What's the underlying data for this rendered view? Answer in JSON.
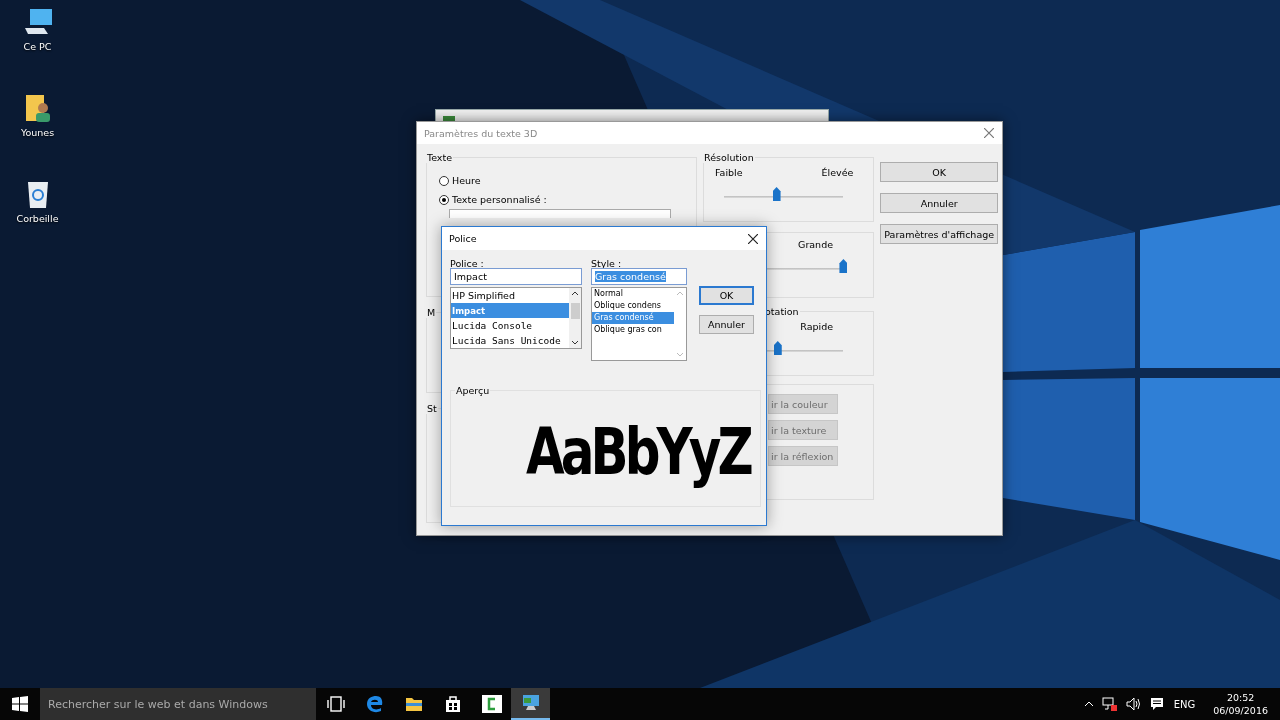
{
  "desktop_icons": [
    {
      "label": "Ce PC",
      "kind": "computer"
    },
    {
      "label": "Younes",
      "kind": "user-folder"
    },
    {
      "label": "Corbeille",
      "kind": "recycle-bin"
    }
  ],
  "main_dialog": {
    "title": "Paramètres du texte 3D",
    "text_group": {
      "label": "Texte",
      "options": [
        {
          "label": "Heure",
          "selected": false
        },
        {
          "label": "Texte personnalisé :",
          "selected": true
        }
      ]
    },
    "group_2_label": "M",
    "group_3_label": "St",
    "resolution": {
      "label": "Résolution",
      "min_label": "Faible",
      "max_label": "Élevée",
      "level": 0.44
    },
    "size": {
      "max_label": "Grande",
      "level": 1.0
    },
    "rotation": {
      "label": "otation",
      "max_label": "Rapide",
      "level": 0.45
    },
    "surface_buttons": [
      "ir la couleur",
      "ir la texture",
      "ir la réflexion"
    ],
    "buttons": [
      "OK",
      "Annuler",
      "Paramètres d'affichage"
    ]
  },
  "font_dialog": {
    "title": "Police",
    "font": {
      "label": "Police :",
      "value": "Impact",
      "items": [
        {
          "label": "HP Simplified",
          "selected": false,
          "kind": "sans"
        },
        {
          "label": "Impact",
          "selected": true,
          "kind": "impact"
        },
        {
          "label": "Lucida Console",
          "selected": false,
          "kind": "mono"
        },
        {
          "label": "Lucida Sans Unicode",
          "selected": false,
          "kind": "mono"
        }
      ]
    },
    "style": {
      "label": "Style :",
      "value": "Gras condensé",
      "value_highlighted": true,
      "items": [
        {
          "label": "Normal",
          "selected": false
        },
        {
          "label": "Oblique condens",
          "selected": false
        },
        {
          "label": "Gras condensé",
          "selected": true
        },
        {
          "label": "Oblique gras con",
          "selected": false
        }
      ]
    },
    "buttons": [
      "OK",
      "Annuler"
    ],
    "preview": {
      "label": "Aperçu",
      "sample": "AaBbYyZ"
    }
  },
  "taskbar": {
    "search_placeholder": "Rechercher sur le web et dans Windows",
    "apps": [
      {
        "kind": "task-view",
        "active": false
      },
      {
        "kind": "edge",
        "active": false
      },
      {
        "kind": "explorer",
        "active": false
      },
      {
        "kind": "store",
        "active": false
      },
      {
        "kind": "camtasia",
        "active": false
      },
      {
        "kind": "screensaver",
        "active": true
      }
    ],
    "language": "ENG",
    "time": "20:52",
    "date": "06/09/2016"
  }
}
